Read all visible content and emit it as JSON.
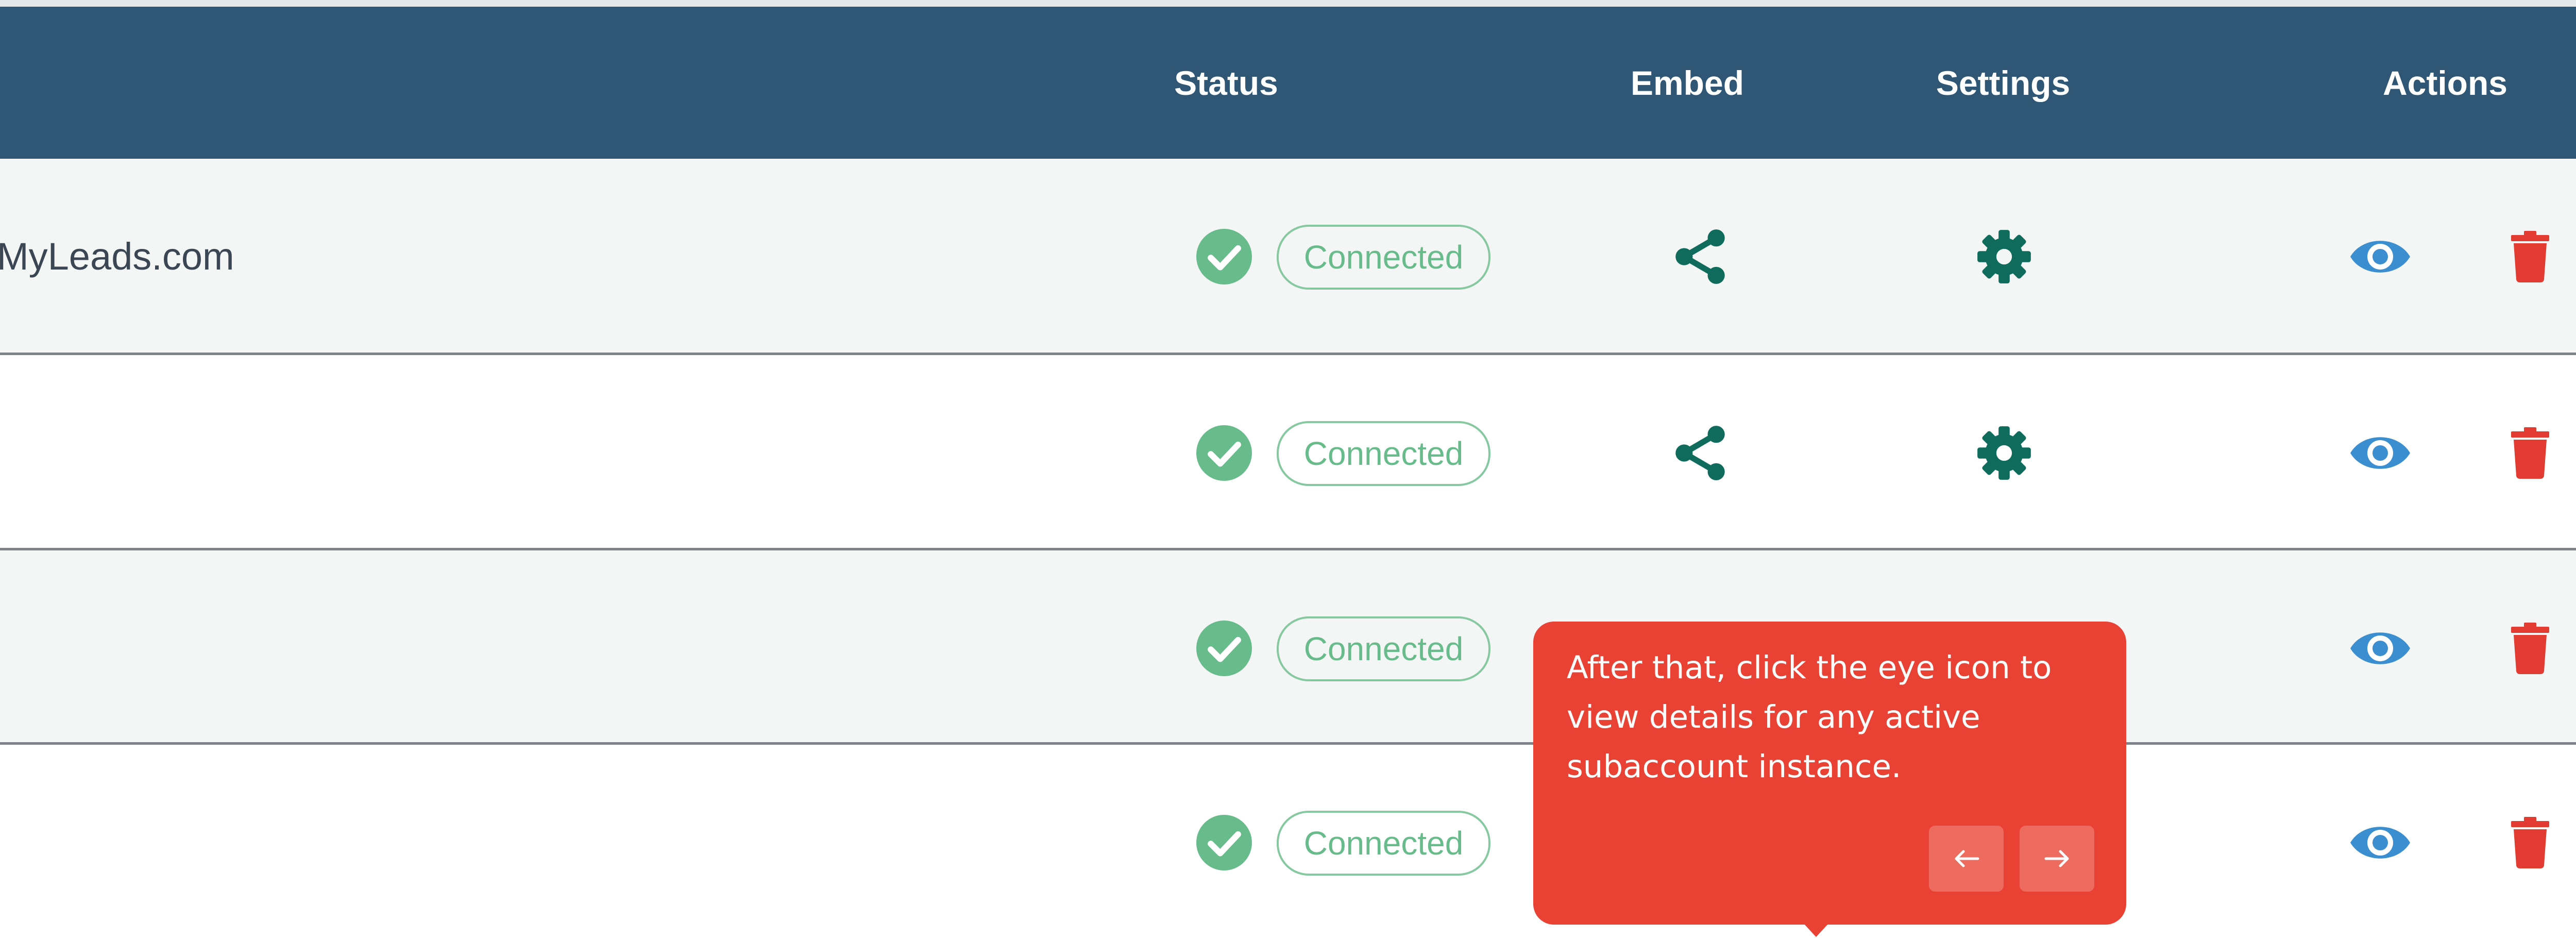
{
  "table": {
    "columns": {
      "status": "Status",
      "embed": "Embed",
      "settings": "Settings",
      "actions": "Actions"
    },
    "rows": [
      {
        "name": "MyLeads.com",
        "status": "Connected"
      },
      {
        "name": "",
        "status": "Connected"
      },
      {
        "name": "",
        "status": "Connected"
      },
      {
        "name": "",
        "status": "Connected"
      }
    ]
  },
  "tooltip": {
    "text": "After that, click the eye icon to view details for any active subaccount instance.",
    "prev_icon": "arrow-left-icon",
    "next_icon": "arrow-right-icon"
  },
  "colors": {
    "header": "#2f5675",
    "connected": "#68bb8b",
    "embed_settings_icon": "#0f6b5c",
    "view_icon": "#3b8fd1",
    "delete_icon": "#e23b32",
    "tooltip": "#e94235"
  }
}
